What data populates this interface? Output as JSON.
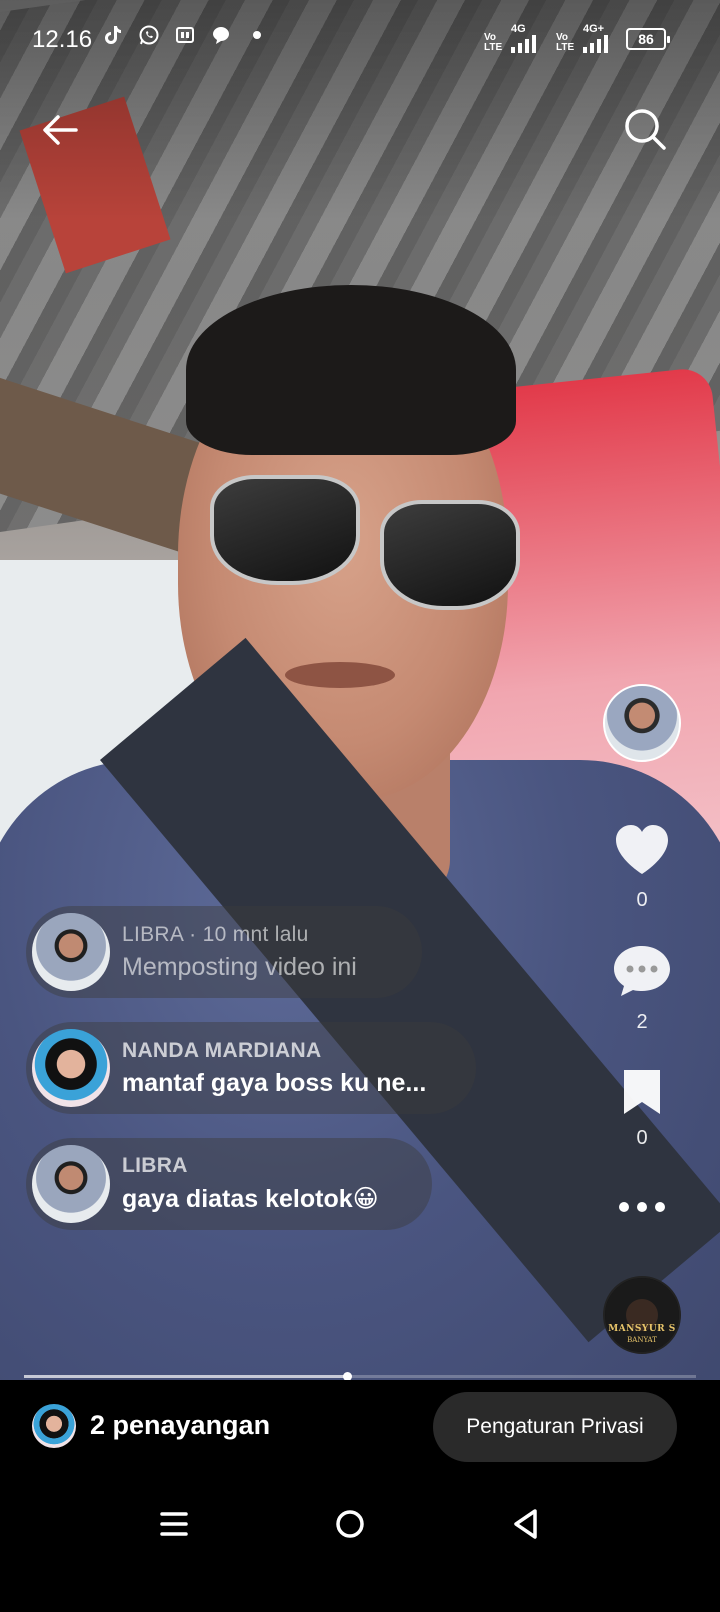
{
  "status_bar": {
    "time": "12.16",
    "notification_icons": [
      "tiktok-icon",
      "whatsapp-icon",
      "app-icon",
      "chat-icon",
      "dot-icon"
    ],
    "signal_1_label": "Vo LTE",
    "network_1": "4G",
    "signal_2_label": "Vo LTE",
    "network_2": "4G+",
    "battery": "86"
  },
  "top_nav": {
    "back_icon": "arrow-left-icon",
    "search_icon": "search-icon"
  },
  "actions": {
    "like_count": "0",
    "comment_count": "2",
    "save_count": "0"
  },
  "sound_disc": {
    "brand": "MANSYUR S",
    "sub": "BANYAT"
  },
  "comments": [
    {
      "name": "LIBRA · 10 mnt lalu",
      "message": "Memposting video ini"
    },
    {
      "name": "NANDA MARDIANA",
      "message": "mantaf gaya boss ku ne..."
    },
    {
      "name": "LIBRA",
      "message": "gaya diatas kelotok😀"
    }
  ],
  "progress": 0.48,
  "bottom_bar": {
    "views": "2 penayangan",
    "privacy_button": "Pengaturan Privasi"
  },
  "colors": {
    "bubble_bg": "#3c3c3c",
    "button_bg": "#2a2a2a",
    "bar_bg": "#000000"
  }
}
